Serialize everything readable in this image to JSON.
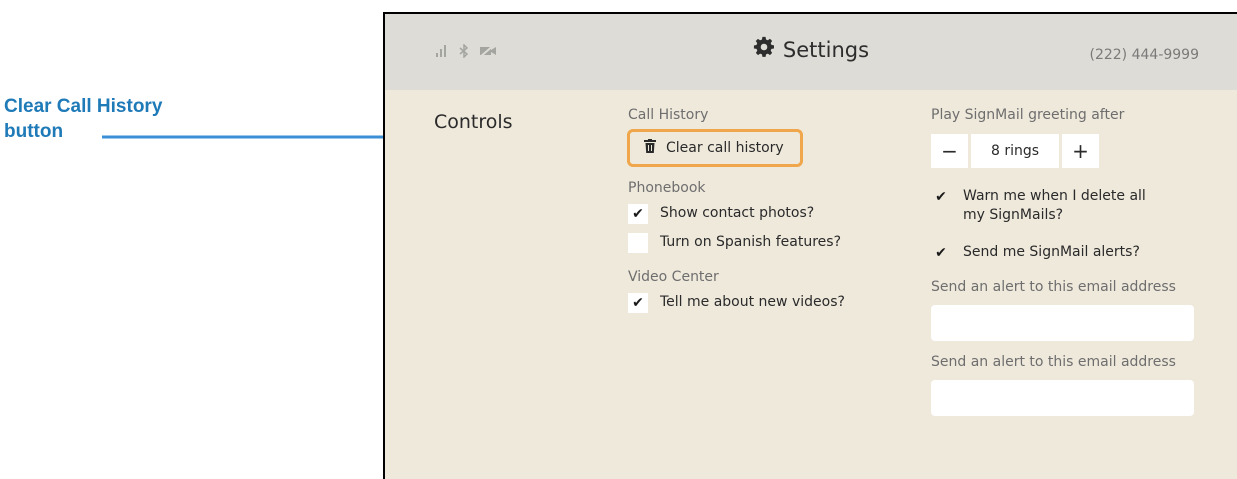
{
  "annotation": {
    "line1": "Clear Call History",
    "line2": "button",
    "color": "#1f7ab8"
  },
  "header": {
    "title": "Settings",
    "title_icon": "gear-icon",
    "phone": "(222) 444-9999",
    "status_icons": [
      "signal-icon",
      "bluetooth-icon",
      "video-off-icon"
    ]
  },
  "page": {
    "controls_label": "Controls"
  },
  "call_history": {
    "label": "Call History",
    "clear_button": "Clear call history",
    "clear_icon": "trash-icon",
    "highlight_color": "#f0a64a"
  },
  "phonebook": {
    "label": "Phonebook",
    "show_photos": {
      "label": "Show contact photos?",
      "checked": true
    },
    "spanish": {
      "label": "Turn on Spanish features?",
      "checked": false
    }
  },
  "video_center": {
    "label": "Video Center",
    "new_videos": {
      "label": "Tell me about new videos?",
      "checked": true
    }
  },
  "signmail": {
    "greeting_label": "Play SignMail greeting after",
    "minus": "−",
    "plus": "+",
    "rings": "8 rings",
    "warn_delete": {
      "label_line1": "Warn me when I delete all",
      "label_line2": "my SignMails?",
      "checked": true
    },
    "alerts": {
      "label": "Send me SignMail alerts?",
      "checked": true
    },
    "email1_label": "Send an alert to this email address",
    "email1_value": "",
    "email2_label": "Send an alert to this email address",
    "email2_value": ""
  }
}
